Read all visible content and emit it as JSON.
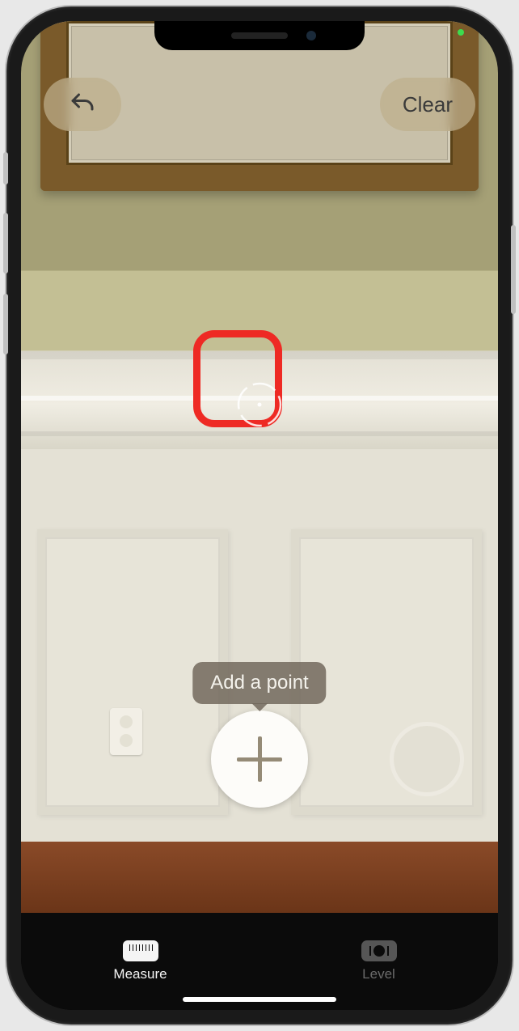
{
  "top_controls": {
    "undo_aria": "Undo",
    "clear_label": "Clear"
  },
  "tooltip": {
    "add_point": "Add a point"
  },
  "tabs": {
    "measure": "Measure",
    "level": "Level"
  },
  "colors": {
    "annotation": "#ee2a24"
  }
}
